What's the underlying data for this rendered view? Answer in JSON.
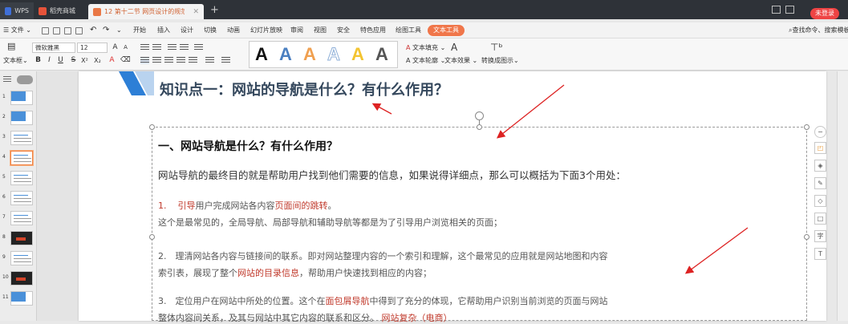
{
  "titlebar": {
    "tabs": [
      {
        "label": "WPS"
      },
      {
        "label": "稻壳商城"
      },
      {
        "label": "12 第十二节 网页设计的规范"
      }
    ],
    "login": "未登录"
  },
  "menubar": {
    "file": "文件",
    "items": [
      "开始",
      "插入",
      "设计",
      "切换",
      "动画",
      "幻灯片放映",
      "审阅",
      "视图",
      "安全",
      "特色应用",
      "绘图工具",
      "文本工具"
    ],
    "active": "文本工具",
    "search": "查找命令、搜索模板"
  },
  "ribbon": {
    "textbox_label": "文本框",
    "font_name": "微软雅黑",
    "font_size": "12",
    "style_letter": "A",
    "text_fill": "文本填充",
    "text_outline": "文本轮廓",
    "text_effect": "文本效果",
    "convert_art": "转换成图示",
    "style_colors": [
      "#111111",
      "#4a7fc1",
      "#f0a050",
      "#8fb0d8",
      "#f3c431",
      "#555555"
    ]
  },
  "thumbnails": [
    {
      "num": "1",
      "type": "blue"
    },
    {
      "num": "2",
      "type": "blue"
    },
    {
      "num": "3",
      "type": "text"
    },
    {
      "num": "4",
      "type": "text",
      "selected": true
    },
    {
      "num": "5",
      "type": "text"
    },
    {
      "num": "6",
      "type": "text"
    },
    {
      "num": "7",
      "type": "text"
    },
    {
      "num": "8",
      "type": "dark"
    },
    {
      "num": "9",
      "type": "text"
    },
    {
      "num": "10",
      "type": "dark"
    },
    {
      "num": "11",
      "type": "blue"
    }
  ],
  "slide": {
    "title": "知识点一：网站的导航是什么？有什么作用？",
    "heading": "一、网站导航是什么？有什么作用？",
    "intro": "网站导航的最终目的就是帮助用户找到他们需要的信息，如果说得详细点，那么可以概括为下面3个用处：",
    "item1": {
      "num": "1.",
      "lead": "引导",
      "mid": "用户完成网站各内容",
      "red2": "页面间的跳转",
      "end": "。"
    },
    "item1b": "这个是最常见的，全局导航、局部导航和辅助导航等都是为了引导用户浏览相关的页面；",
    "item2": "2.　理清网站各内容与链接间的联系。即对网站整理内容的一个索引和理解，这个最常见的应用就是网站地图和内容",
    "item2b": {
      "pre": "索引表，展现了整个",
      "red": "网站的目录信息",
      "post": "，帮助用户快速找到相应的内容；"
    },
    "item3": {
      "pre": "3.　定位用户在网站中所处的位置。这个在",
      "red": "面包屑导航",
      "post": "中得到了充分的体现，它帮助用户识别当前浏览的页面与网站"
    },
    "item3b": {
      "pre": "整体内容间关系，及其与网站中其它内容的联系和区分。",
      "red": "网站复杂（电商）"
    }
  },
  "right_tools": [
    "minus-icon",
    "shape-icon",
    "layers-icon",
    "pen-icon",
    "fill-icon",
    "frame-icon",
    "text-icon",
    "translate-icon"
  ]
}
